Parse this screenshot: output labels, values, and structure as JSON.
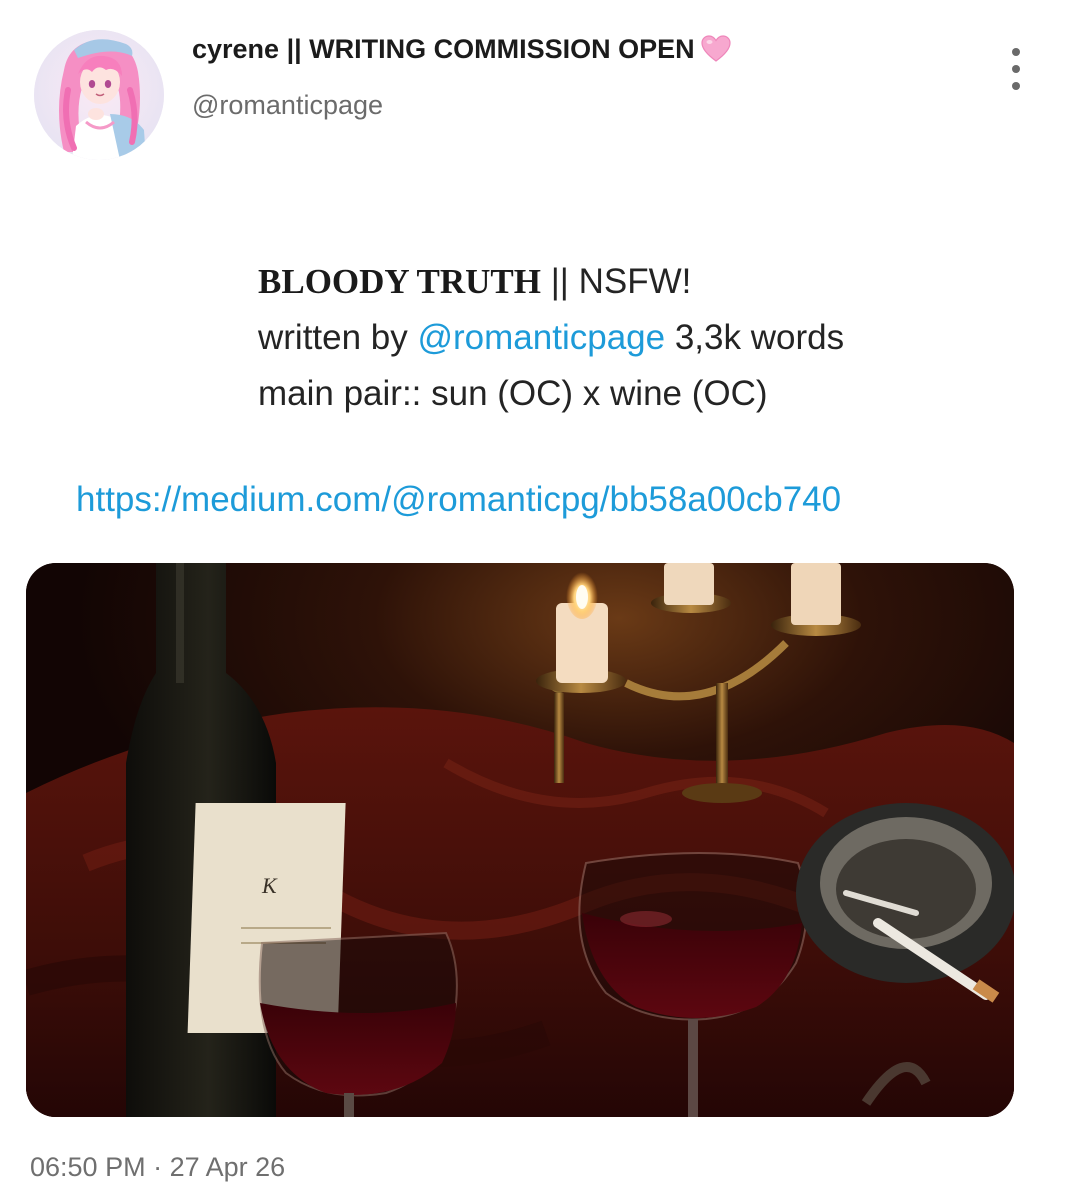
{
  "user": {
    "display_name": "cyrene || WRITING COMMISSION OPEN",
    "handle": "@romanticpage"
  },
  "icons": {
    "heart": "pink-heart-icon",
    "more": "three-dots-vertical-icon"
  },
  "post": {
    "story_title": "BLOODY TRUTH",
    "title_suffix": " || NSFW!",
    "written_by_label": "written by ",
    "author_mention": "@romanticpage",
    "word_count": " 3,3k words",
    "pairing": "main pair:: sun (OC) x wine (OC)",
    "link": "https://medium.com/@romanticpg/bb58a00cb740"
  },
  "timestamp": {
    "time": "06:50 PM",
    "separator": " · ",
    "date": "27 Apr 26"
  },
  "colors": {
    "link": "#1d9bd9",
    "heart": "#f7a8cf",
    "secondary_text": "#6b6b6b"
  }
}
